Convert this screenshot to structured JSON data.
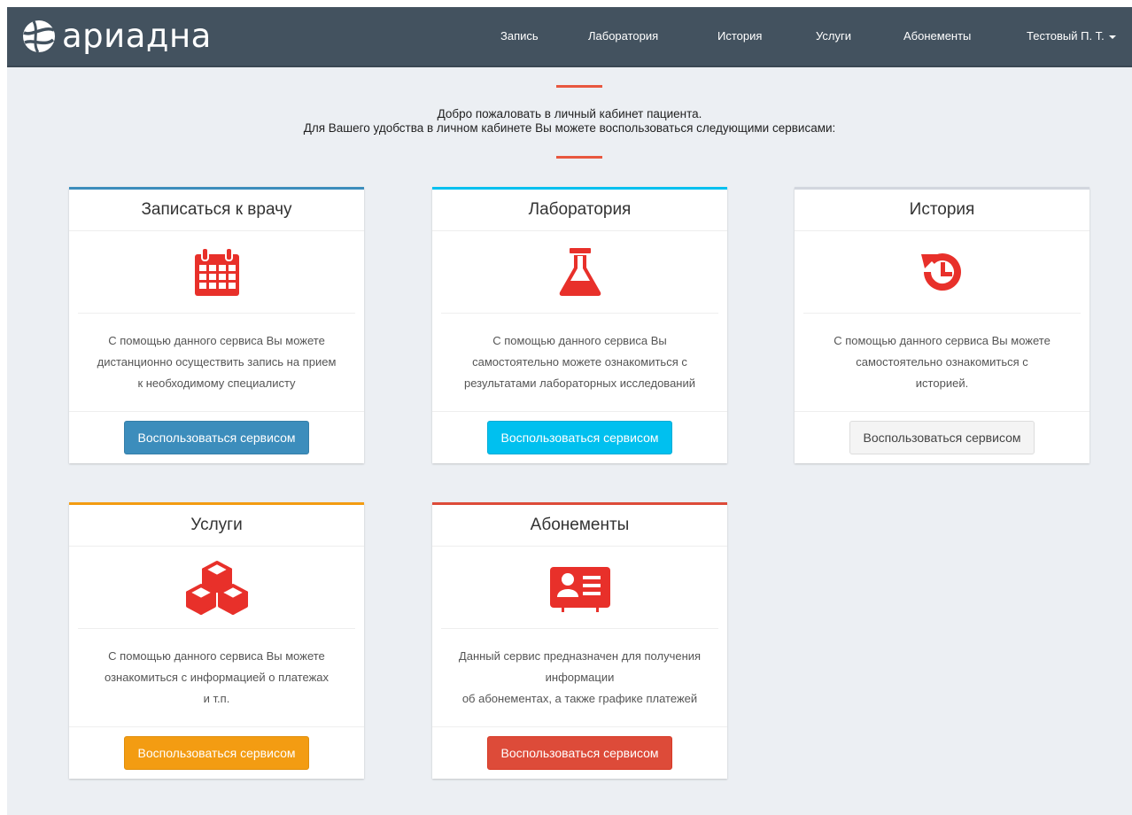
{
  "brand": {
    "name": "ариадна"
  },
  "nav": {
    "items": [
      "Запись",
      "Лаборатория",
      "История",
      "Услуги",
      "Абонементы"
    ],
    "user": "Тестовый П. Т."
  },
  "welcome": {
    "line1": "Добро пожаловать в личный кабинет пациента.",
    "line2": "Для Вашего удобства в личном кабинете Вы можете воспользоваться следующими сервисами:"
  },
  "colors": {
    "navbar": "#43525f",
    "accent_rule": "#e8573f",
    "icon": "#e8302a"
  },
  "cards": [
    {
      "title": "Записаться к врачу",
      "icon": "calendar-icon",
      "border_color": "#3c8dbc",
      "description": "С помощью данного сервиса Вы можете\nдистанционно осуществить запись на прием\nк необходимому специалисту",
      "button": "Воспользоваться сервисом"
    },
    {
      "title": "Лаборатория",
      "icon": "flask-icon",
      "border_color": "#00c0ef",
      "description": "С помощью данного сервиса Вы\nсамостоятельно можете ознакомиться с\nрезультатами лабораторных исследований",
      "button": "Воспользоваться сервисом"
    },
    {
      "title": "История",
      "icon": "history-icon",
      "border_color": "#d2d6de",
      "description": "С помощью данного сервиса Вы можете\nсамостоятельно ознакомиться с\nисторией.",
      "button": "Воспользоваться сервисом"
    },
    {
      "title": "Услуги",
      "icon": "cubes-icon",
      "border_color": "#f39c12",
      "description": "С помощью данного сервиса Вы можете\nознакомиться с информацией о платежах\nи т.п.",
      "button": "Воспользоваться сервисом"
    },
    {
      "title": "Абонементы",
      "icon": "id-card-icon",
      "border_color": "#dd4b39",
      "description": "Данный сервис предназначен для получения\nинформации\nоб абонементах, а также графике платежей",
      "button": "Воспользоваться сервисом"
    }
  ]
}
